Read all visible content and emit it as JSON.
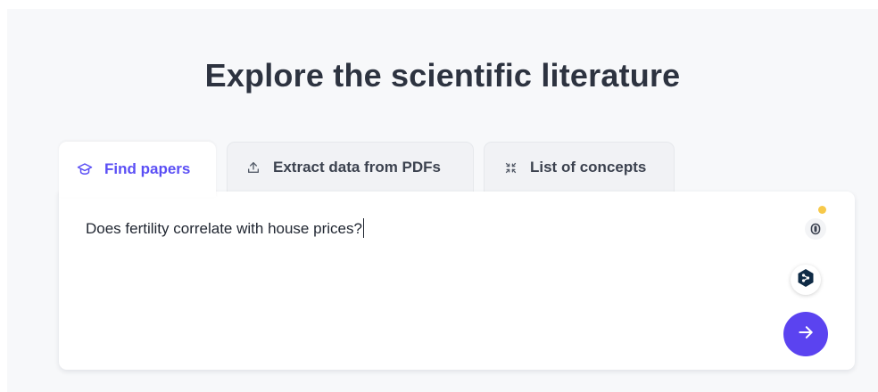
{
  "page": {
    "heading": "Explore the scientific literature"
  },
  "tabs": [
    {
      "label": "Find papers",
      "icon": "graduation-cap-icon",
      "active": true
    },
    {
      "label": "Extract data from PDFs",
      "icon": "upload-icon",
      "active": false
    },
    {
      "label": "List of concepts",
      "icon": "collapse-arrows-icon",
      "active": false
    }
  ],
  "search": {
    "value": "Does fertility correlate with house prices?"
  },
  "colors": {
    "accent": "#5b43f0",
    "active_tab_text": "#5b4ff5",
    "heading": "#2d3340",
    "notification_dot": "#f7c94a",
    "page_background": "#f7f8fa"
  },
  "icons": {
    "extension": "extension-icon",
    "deepl": "deepl-icon",
    "submit": "arrow-right-icon"
  }
}
